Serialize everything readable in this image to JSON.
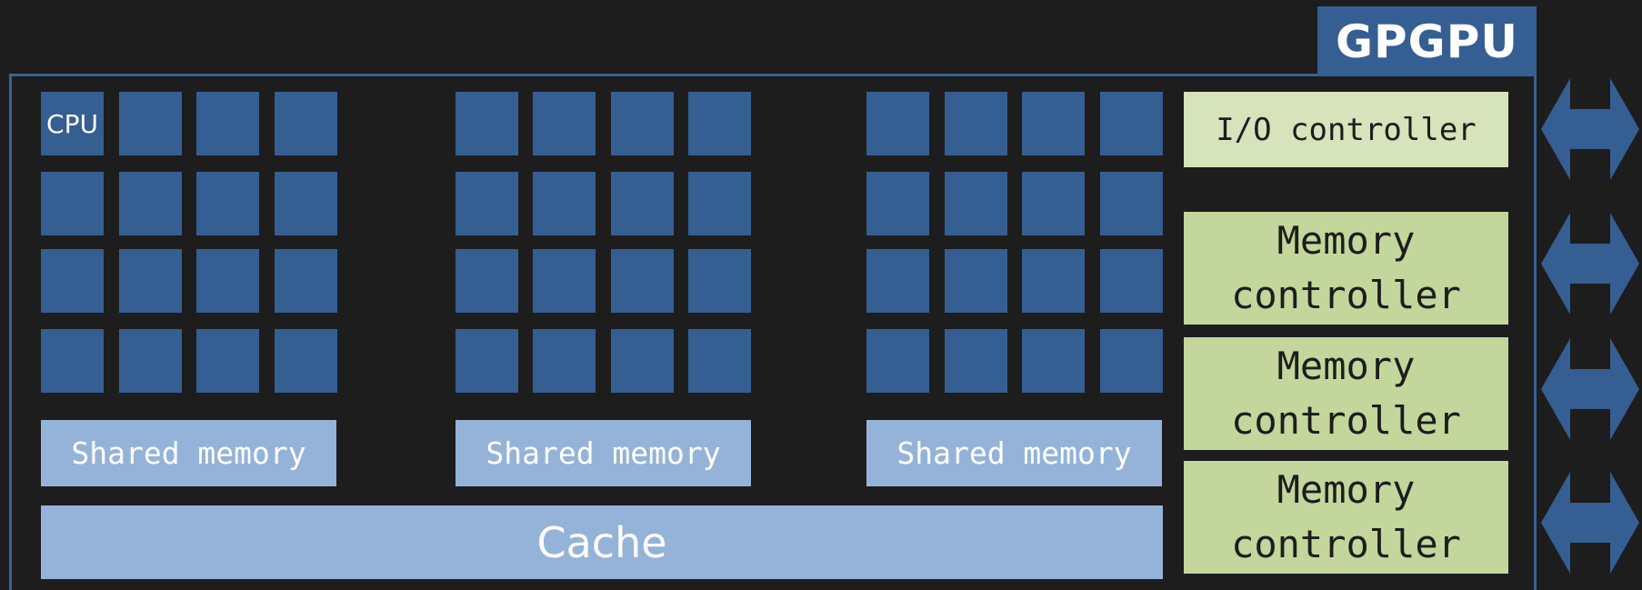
{
  "title": "GPGPU",
  "core_label": "CPU",
  "shared_memory_label": "Shared memory",
  "cache_label": "Cache",
  "io_controller_label": "I/O controller",
  "memory_controller_label": [
    "Memory",
    "controller"
  ],
  "colors": {
    "background": "#1d1d1d",
    "core": "#355e92",
    "shared_memory": "#95b3d8",
    "io_controller": "#d6e3bb",
    "memory_controller": "#c3d69b"
  },
  "blocks": [
    {
      "name": "block-1",
      "cores": 16
    },
    {
      "name": "block-2",
      "cores": 16
    },
    {
      "name": "block-3",
      "cores": 16
    }
  ],
  "memory_controllers": 3,
  "io_arrows": 4
}
